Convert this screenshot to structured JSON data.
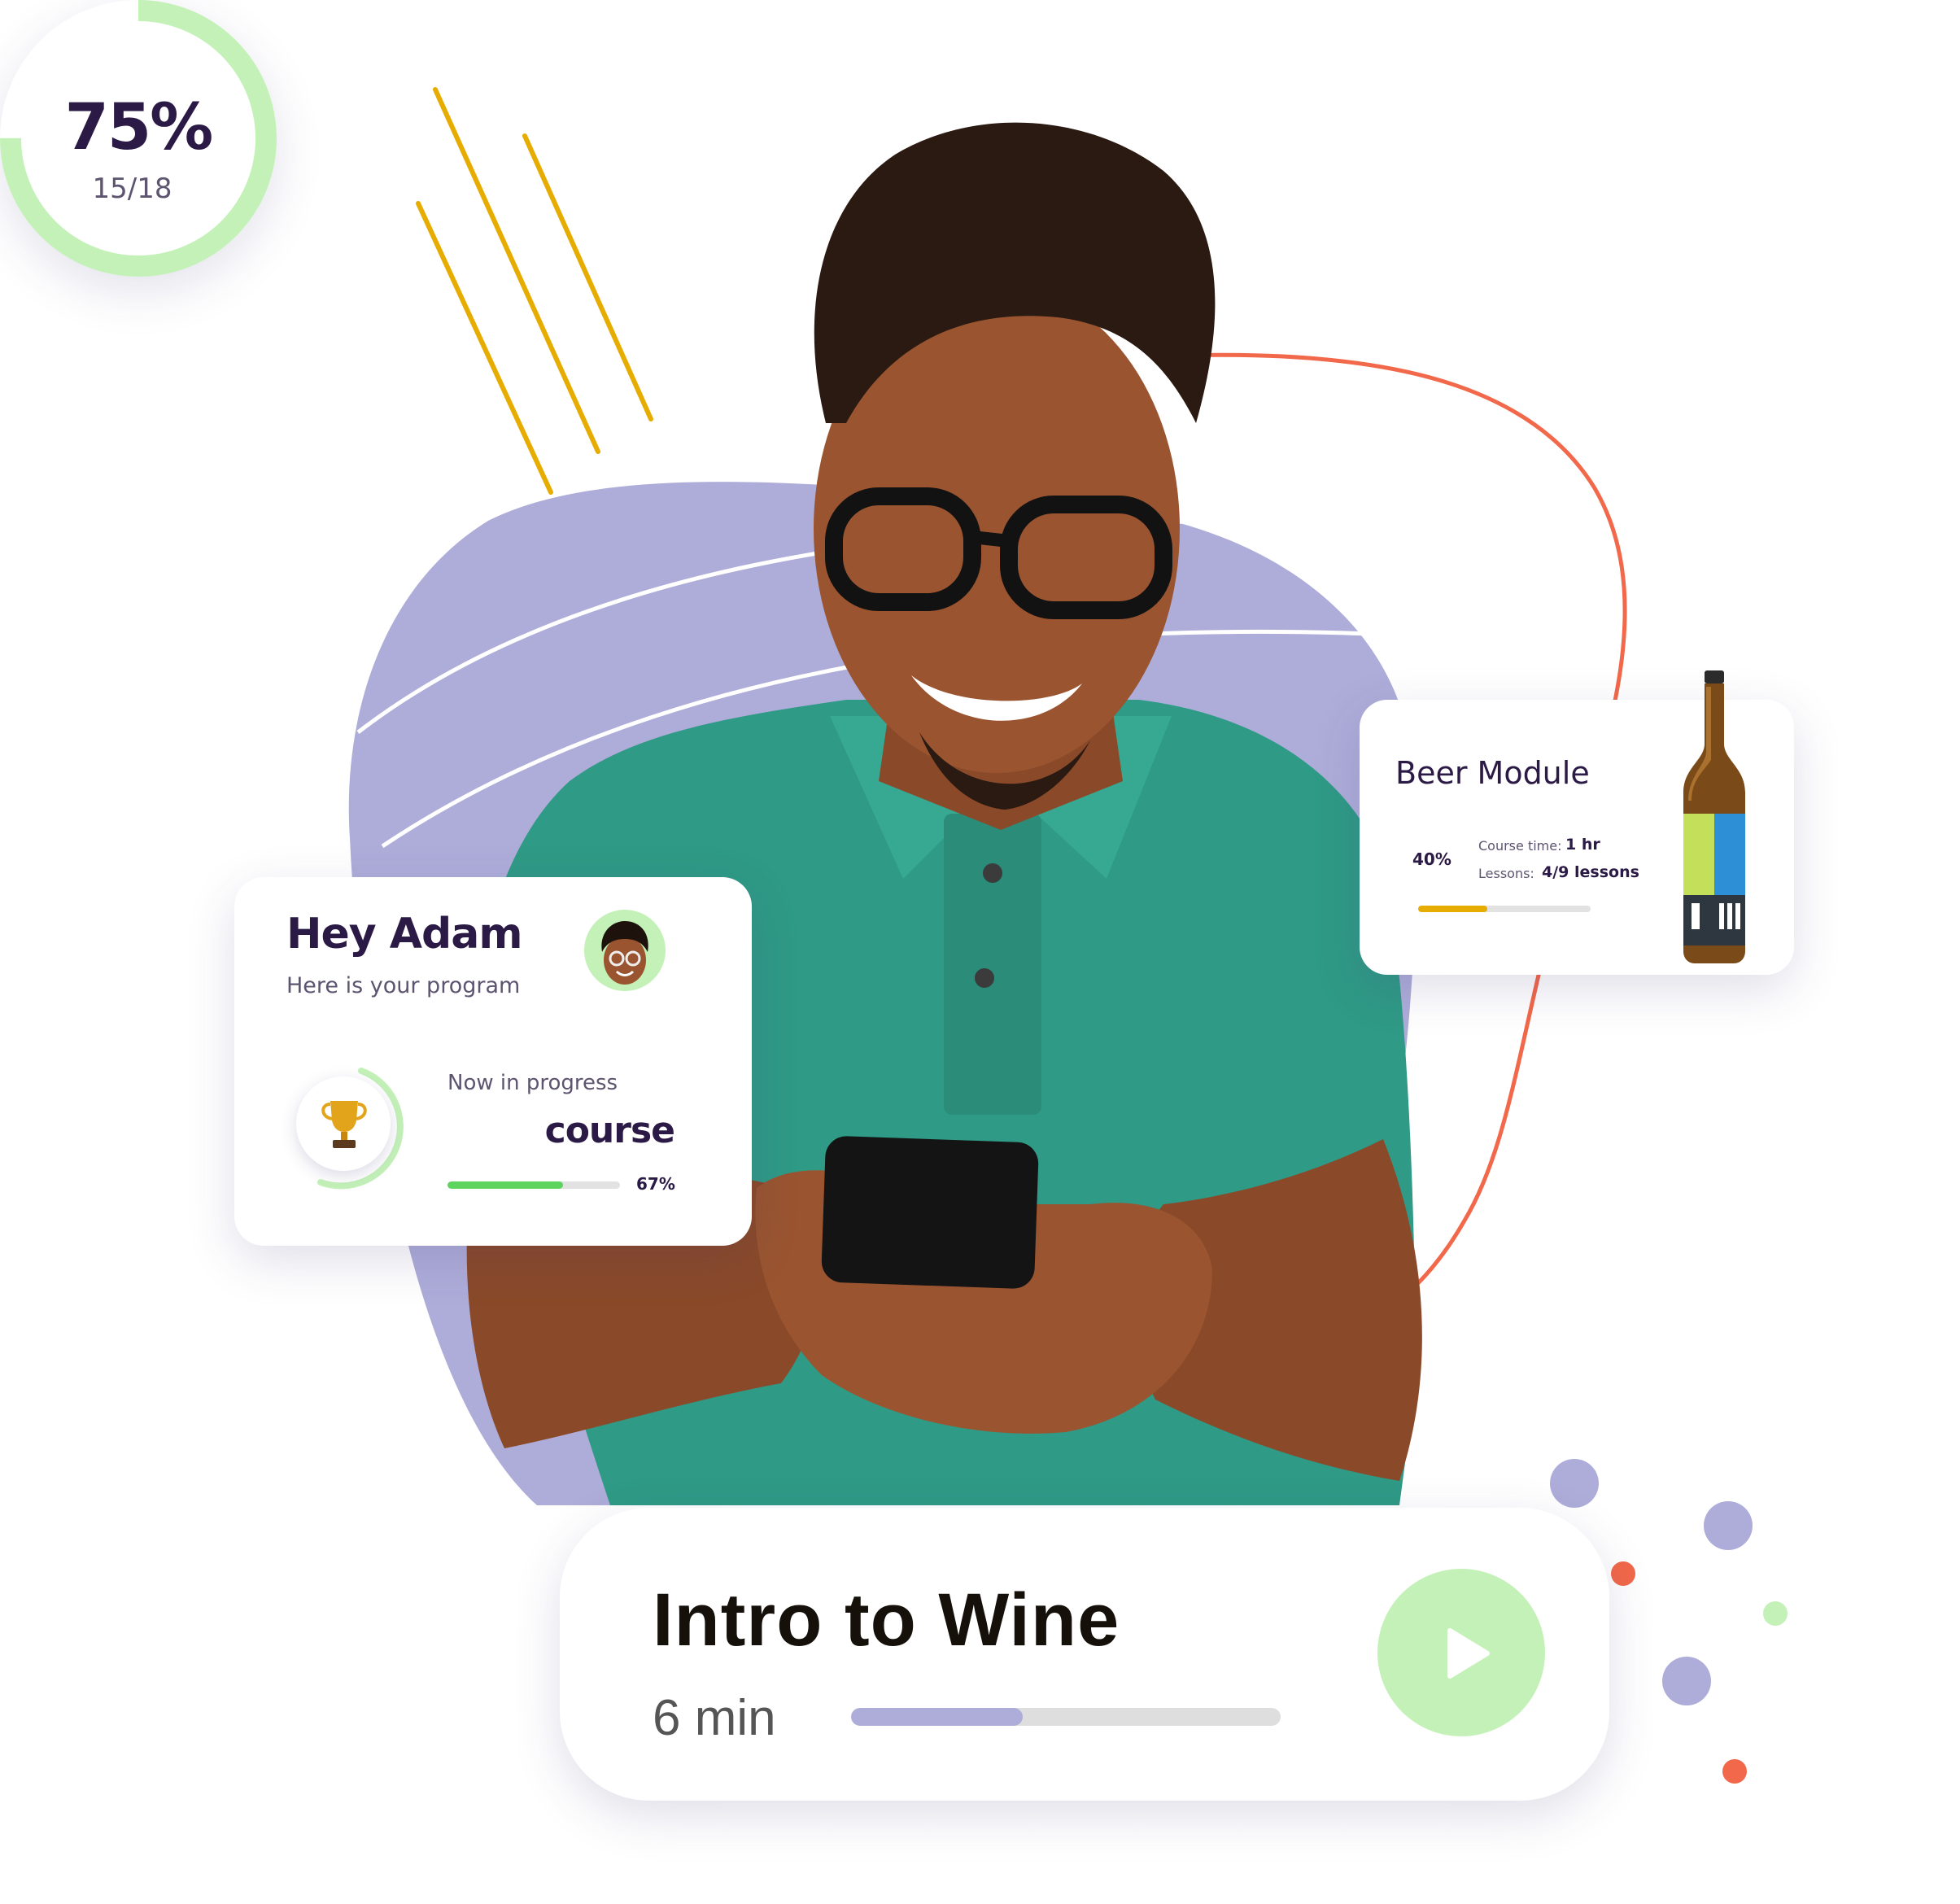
{
  "colors": {
    "purple_blob": "#aeadd9",
    "orange_line": "#f2684a",
    "gold_lines": "#e6ad00",
    "green_ring": "#c4f1b8",
    "green_bar": "#5ed35e",
    "text_dark": "#2a1a45"
  },
  "progress_ring": {
    "percent": "75%",
    "fraction": "15/18",
    "value": 0.75
  },
  "program_card": {
    "greeting": "Hey Adam",
    "subtitle": "Here is your program",
    "avatar_icon": "memoji-avatar-icon",
    "trophy_icon": "trophy-icon",
    "status_label": "Now in progress",
    "course_name": "course",
    "progress_value": 0.67,
    "progress_label": "67%"
  },
  "beer_module": {
    "title": "Beer Module",
    "progress_label": "40%",
    "progress_value": 0.4,
    "course_time_label": "Course time:",
    "course_time_value": "1 hr",
    "lessons_label": "Lessons:",
    "lessons_value": "4/9 lessons",
    "image_icon": "beer-bottle-icon"
  },
  "lesson_card": {
    "title": "Intro to Wine",
    "duration": "6 min",
    "progress_value": 0.4,
    "play_icon": "play-icon"
  }
}
